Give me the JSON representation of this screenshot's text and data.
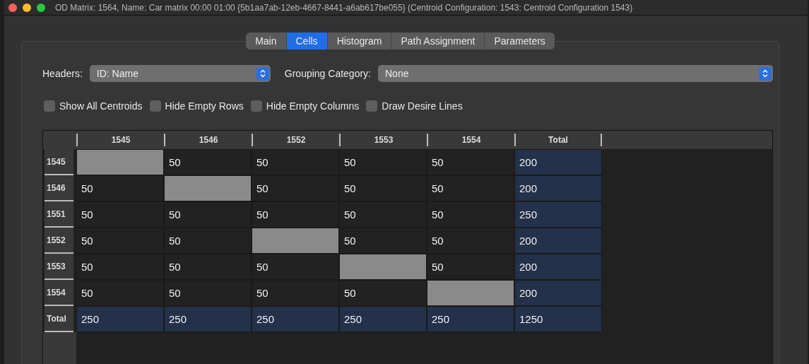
{
  "window": {
    "title": "OD Matrix: 1564, Name: Car matrix 00:00 01:00  {5b1aa7ab-12eb-4667-8441-a6ab617be055} (Centroid Configuration: 1543: Centroid Configuration 1543)"
  },
  "tabs": [
    {
      "label": "Main",
      "selected": false
    },
    {
      "label": "Cells",
      "selected": true
    },
    {
      "label": "Histogram",
      "selected": false
    },
    {
      "label": "Path Assignment",
      "selected": false
    },
    {
      "label": "Parameters",
      "selected": false
    }
  ],
  "headers": {
    "label": "Headers:",
    "value": "ID: Name"
  },
  "grouping": {
    "label": "Grouping Category:",
    "value": "None"
  },
  "options": [
    {
      "label": "Show All Centroids",
      "checked": false
    },
    {
      "label": "Hide Empty Rows",
      "checked": false
    },
    {
      "label": "Hide Empty Columns",
      "checked": false
    },
    {
      "label": "Draw Desire Lines",
      "checked": false
    }
  ],
  "table": {
    "columns": [
      "1545",
      "1546",
      "1552",
      "1553",
      "1554",
      "Total"
    ],
    "rows": [
      {
        "header": "1545",
        "cells": [
          {
            "kind": "blocked"
          },
          {
            "kind": "value",
            "text": "50"
          },
          {
            "kind": "value",
            "text": "50"
          },
          {
            "kind": "value",
            "text": "50"
          },
          {
            "kind": "value",
            "text": "50"
          },
          {
            "kind": "total",
            "text": "200"
          }
        ]
      },
      {
        "header": "1546",
        "cells": [
          {
            "kind": "value",
            "text": "50"
          },
          {
            "kind": "blocked"
          },
          {
            "kind": "value",
            "text": "50"
          },
          {
            "kind": "value",
            "text": "50"
          },
          {
            "kind": "value",
            "text": "50"
          },
          {
            "kind": "total",
            "text": "200"
          }
        ]
      },
      {
        "header": "1551",
        "cells": [
          {
            "kind": "value",
            "text": "50"
          },
          {
            "kind": "value",
            "text": "50"
          },
          {
            "kind": "value",
            "text": "50"
          },
          {
            "kind": "value",
            "text": "50"
          },
          {
            "kind": "value",
            "text": "50"
          },
          {
            "kind": "total",
            "text": "250"
          }
        ]
      },
      {
        "header": "1552",
        "cells": [
          {
            "kind": "value",
            "text": "50"
          },
          {
            "kind": "value",
            "text": "50"
          },
          {
            "kind": "blocked"
          },
          {
            "kind": "value",
            "text": "50"
          },
          {
            "kind": "value",
            "text": "50"
          },
          {
            "kind": "total",
            "text": "200"
          }
        ]
      },
      {
        "header": "1553",
        "cells": [
          {
            "kind": "value",
            "text": "50"
          },
          {
            "kind": "value",
            "text": "50"
          },
          {
            "kind": "value",
            "text": "50"
          },
          {
            "kind": "blocked"
          },
          {
            "kind": "value",
            "text": "50"
          },
          {
            "kind": "total",
            "text": "200"
          }
        ]
      },
      {
        "header": "1554",
        "cells": [
          {
            "kind": "value",
            "text": "50"
          },
          {
            "kind": "value",
            "text": "50"
          },
          {
            "kind": "value",
            "text": "50"
          },
          {
            "kind": "value",
            "text": "50"
          },
          {
            "kind": "blocked"
          },
          {
            "kind": "total",
            "text": "200"
          }
        ]
      },
      {
        "header": "Total",
        "cells": [
          {
            "kind": "total",
            "text": "250"
          },
          {
            "kind": "total",
            "text": "250"
          },
          {
            "kind": "total",
            "text": "250"
          },
          {
            "kind": "total",
            "text": "250"
          },
          {
            "kind": "total",
            "text": "250"
          },
          {
            "kind": "total",
            "text": "1250"
          }
        ]
      }
    ]
  }
}
